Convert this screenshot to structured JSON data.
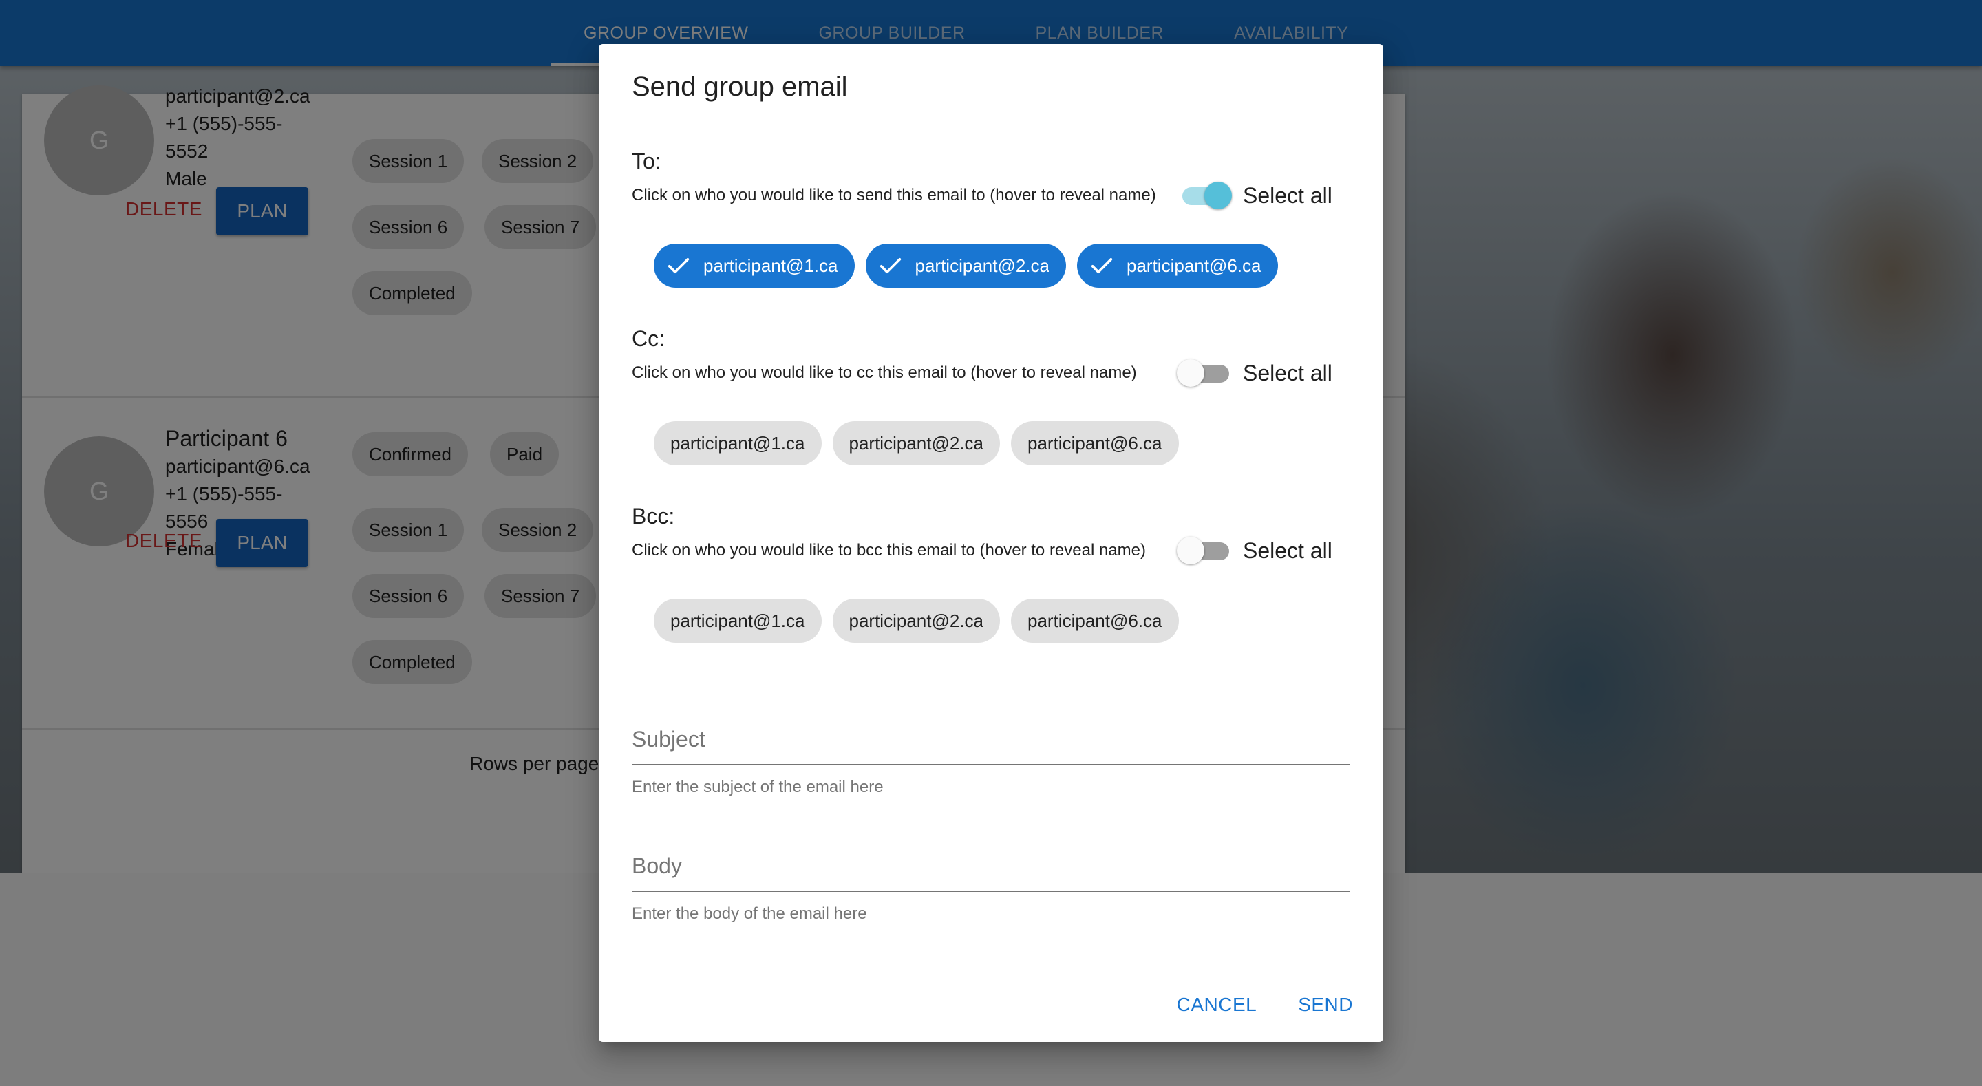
{
  "nav": {
    "tabs": [
      {
        "label": "GROUP OVERVIEW"
      },
      {
        "label": "GROUP BUILDER"
      },
      {
        "label": "PLAN BUILDER"
      },
      {
        "label": "AVAILABILITY"
      }
    ]
  },
  "background": {
    "participants": [
      {
        "avatar": "G",
        "name": "",
        "email": "participant@2.ca",
        "phone1": "+1 (555)-555-",
        "phone2": "5552",
        "gender": "Male",
        "delete_label": "DELETE",
        "plan_label": "PLAN",
        "chips": [
          "Session 1",
          "Session 2",
          "Session 6",
          "Session 7",
          "Completed"
        ]
      },
      {
        "avatar": "G",
        "name": "Participant 6",
        "email": "participant@6.ca",
        "phone1": "+1 (555)-555-",
        "phone2": "5556",
        "gender": "Female",
        "delete_label": "DELETE",
        "plan_label": "PLAN",
        "chips": [
          "Confirmed",
          "Paid",
          "Session 1",
          "Session 2",
          "Session 6",
          "Session 7",
          "Completed"
        ]
      }
    ],
    "rows_per_page_label": "Rows per page:"
  },
  "dialog": {
    "title": "Send group email",
    "to": {
      "label": "To:",
      "help": "Click on who you would like to send this email to (hover to reveal name)",
      "select_all_label": "Select all",
      "select_all_on": true,
      "recipients": [
        "participant@1.ca",
        "participant@2.ca",
        "participant@6.ca"
      ]
    },
    "cc": {
      "label": "Cc:",
      "help": "Click on who you would like to cc this email to (hover to reveal name)",
      "select_all_label": "Select all",
      "select_all_on": false,
      "recipients": [
        "participant@1.ca",
        "participant@2.ca",
        "participant@6.ca"
      ]
    },
    "bcc": {
      "label": "Bcc:",
      "help": "Click on who you would like to bcc this email to (hover to reveal name)",
      "select_all_label": "Select all",
      "select_all_on": false,
      "recipients": [
        "participant@1.ca",
        "participant@2.ca",
        "participant@6.ca"
      ]
    },
    "subject": {
      "label": "Subject",
      "value": "",
      "helper": "Enter the subject of the email here"
    },
    "body": {
      "label": "Body",
      "value": "",
      "helper": "Enter the body of the email here"
    },
    "cancel_label": "CANCEL",
    "send_label": "SEND"
  },
  "colors": {
    "appbar": "#1976d2",
    "chip_selected": "#1976d2",
    "chip_unselected": "#e0e0e0",
    "switch_on": "#55bfd9",
    "delete": "#d32f2f",
    "plan_button": "#1565c0"
  }
}
